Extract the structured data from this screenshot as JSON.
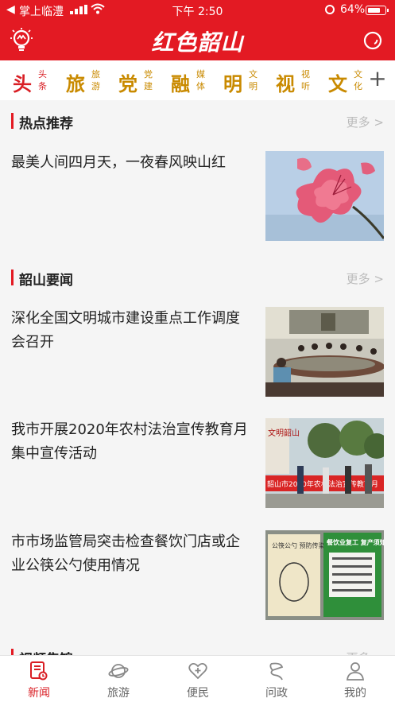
{
  "status_bar": {
    "back_glyph": "◀",
    "carrier": "掌上临澧",
    "time": "下午 2:50",
    "battery": "64%"
  },
  "header": {
    "logo_text": "红色韶山",
    "left_icon": "bulb-icon",
    "right_icon": "search-icon",
    "color": "#e31a23"
  },
  "channels": [
    {
      "big": "头",
      "small": "头条",
      "active": true
    },
    {
      "big": "旅",
      "small": "旅游"
    },
    {
      "big": "党",
      "small": "党建"
    },
    {
      "big": "融",
      "small": "媒体"
    },
    {
      "big": "明",
      "small": "文明"
    },
    {
      "big": "视",
      "small": "视听"
    },
    {
      "big": "文",
      "small": "文化"
    }
  ],
  "channel_add": "+",
  "sections": {
    "hot": {
      "title": "热点推荐",
      "more": "更多 >"
    },
    "news": {
      "title": "韶山要闻",
      "more": "更多 >"
    },
    "video": {
      "title": "视频集锦",
      "more": "更多 >"
    }
  },
  "articles": {
    "hot1": "最美人间四月天，一夜春风映山红",
    "news1": "深化全国文明城市建设重点工作调度会召开",
    "news2": "我市开展2020年农村法治宣传教育月集中宣传活动",
    "news3": "市市场监管局突击检查餐饮门店或企业公筷公勺使用情况"
  },
  "image_text": {
    "photo2_sign": "文明韶山",
    "photo2_banner": "韶山市2020年农村法治宣传教育月",
    "photo3_left_title": "公筷公勺 预防传染",
    "photo3_right_title": "餐饮业复工 复产须知"
  },
  "tabs": [
    {
      "label": "新闻",
      "icon": "news-icon",
      "active": true
    },
    {
      "label": "旅游",
      "icon": "planet-icon"
    },
    {
      "label": "便民",
      "icon": "heart-plus-icon"
    },
    {
      "label": "问政",
      "icon": "dragon-icon"
    },
    {
      "label": "我的",
      "icon": "person-icon"
    }
  ],
  "colors": {
    "accent": "#e31a23",
    "channel_gold": "#c98a00",
    "muted": "#bbbbbb"
  }
}
